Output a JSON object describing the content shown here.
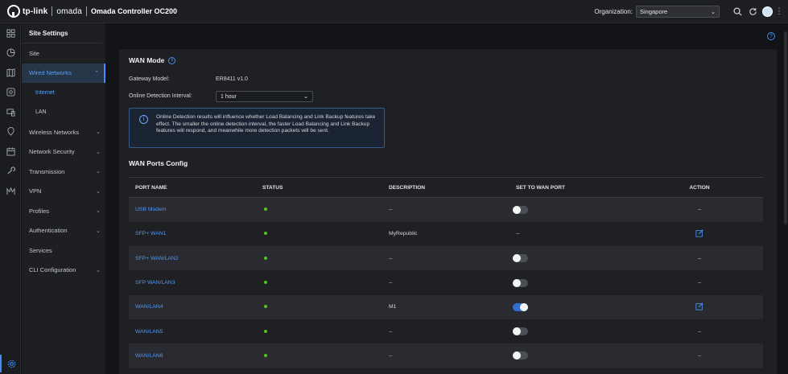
{
  "topbar": {
    "brand": "tp-link",
    "brand2": "omada",
    "title": "Omada Controller OC200",
    "org_label": "Organization:",
    "org_value": "Singapore"
  },
  "rail_icons": [
    "dashboard-icon",
    "statistics-icon",
    "map-icon",
    "devices-icon",
    "clients-icon",
    "location-icon",
    "calendar-icon",
    "tools-icon",
    "insights-icon",
    "settings-icon"
  ],
  "menu": {
    "heading": "Site Settings",
    "items": [
      {
        "label": "Site",
        "chevron": false
      },
      {
        "label": "Wired Networks",
        "chevron": true,
        "active": true
      },
      {
        "label": "Internet",
        "sub": true,
        "active": true
      },
      {
        "label": "LAN",
        "sub": true
      },
      {
        "label": "Wireless Networks",
        "chevron": true
      },
      {
        "label": "Network Security",
        "chevron": true
      },
      {
        "label": "Transmission",
        "chevron": true
      },
      {
        "label": "VPN",
        "chevron": true
      },
      {
        "label": "Profiles",
        "chevron": true
      },
      {
        "label": "Authentication",
        "chevron": true
      },
      {
        "label": "Services",
        "chevron": false
      },
      {
        "label": "CLI Configuration",
        "chevron": true
      }
    ]
  },
  "wan": {
    "title": "WAN Mode",
    "gateway_label": "Gateway Model:",
    "gateway_value": "ER8411 v1.0",
    "interval_label": "Online Detection Interval:",
    "interval_value": "1 hour",
    "notice": "Online Detection results will influence whether Load Balancing and Link Backup features take effect. The smaller the online detection interval, the faster Load Balancing and Link Backup features will respond, and meanwhile more detection packets will be sent."
  },
  "ports": {
    "title": "WAN Ports Config",
    "columns": [
      "PORT NAME",
      "STATUS",
      "DESCRIPTION",
      "SET TO WAN PORT",
      "ACTION"
    ],
    "rows": [
      {
        "name": "USB Modem",
        "description": "--",
        "wan": "off",
        "action": "--"
      },
      {
        "name": "SFP+ WAN1",
        "description": "MyRepublic",
        "wan": "--",
        "action": "edit"
      },
      {
        "name": "SFP+ WAN/LAN2",
        "description": "--",
        "wan": "off",
        "action": "--"
      },
      {
        "name": "SFP WAN/LAN3",
        "description": "--",
        "wan": "off",
        "action": "--"
      },
      {
        "name": "WAN/LAN4",
        "description": "M1",
        "wan": "on",
        "action": "edit"
      },
      {
        "name": "WAN/LAN5",
        "description": "--",
        "wan": "off",
        "action": "--"
      },
      {
        "name": "WAN/LAN6",
        "description": "--",
        "wan": "off",
        "action": "--"
      }
    ]
  },
  "colors": {
    "accent": "#3f8df5",
    "status_online": "#52c41a",
    "background": "#131417"
  }
}
